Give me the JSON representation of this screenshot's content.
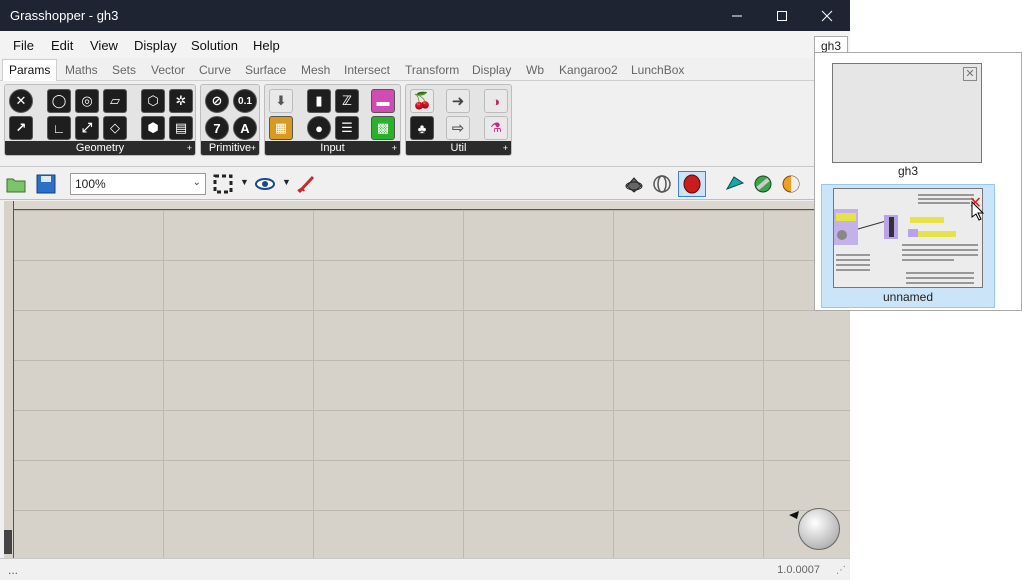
{
  "window": {
    "title": "Grasshopper - gh3"
  },
  "menu": [
    "File",
    "Edit",
    "View",
    "Display",
    "Solution",
    "Help"
  ],
  "tabs": [
    "Params",
    "Maths",
    "Sets",
    "Vector",
    "Curve",
    "Surface",
    "Mesh",
    "Intersect",
    "Transform",
    "Display",
    "Wb",
    "Kangaroo2",
    "LunchBox"
  ],
  "active_tab": "Params",
  "ribbon_groups": [
    "Geometry",
    "Primitive",
    "Input",
    "Util"
  ],
  "primitive_labels": {
    "number": "0.1",
    "integer": "7",
    "text": "A"
  },
  "toolbar": {
    "zoom_value": "100%"
  },
  "status": {
    "left": "...",
    "version": "1.0.0007"
  },
  "doc_browser": {
    "tab_label": "gh3",
    "documents": [
      {
        "name": "gh3"
      },
      {
        "name": "unnamed"
      }
    ]
  },
  "colors": {
    "titlebar": "#1f2433",
    "canvas": "#d6d2ca",
    "selection": "#cce4f7"
  }
}
